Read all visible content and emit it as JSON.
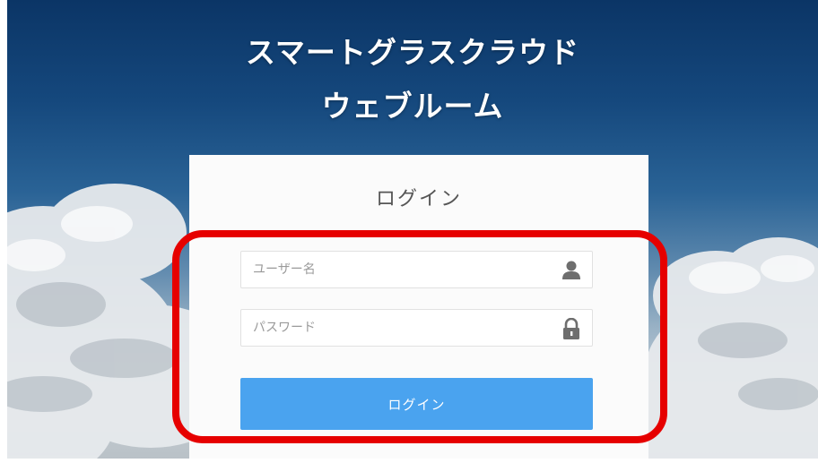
{
  "header": {
    "title_line1": "スマートグラスクラウド",
    "title_line2": "ウェブルーム"
  },
  "login": {
    "heading": "ログイン",
    "username_placeholder": "ユーザー名",
    "username_value": "",
    "username_icon": "user-icon",
    "password_placeholder": "パスワード",
    "password_value": "",
    "password_icon": "lock-icon",
    "submit_label": "ログイン"
  },
  "colors": {
    "button": "#4aa3ef",
    "highlight": "#e60000",
    "title": "#ffffff"
  }
}
